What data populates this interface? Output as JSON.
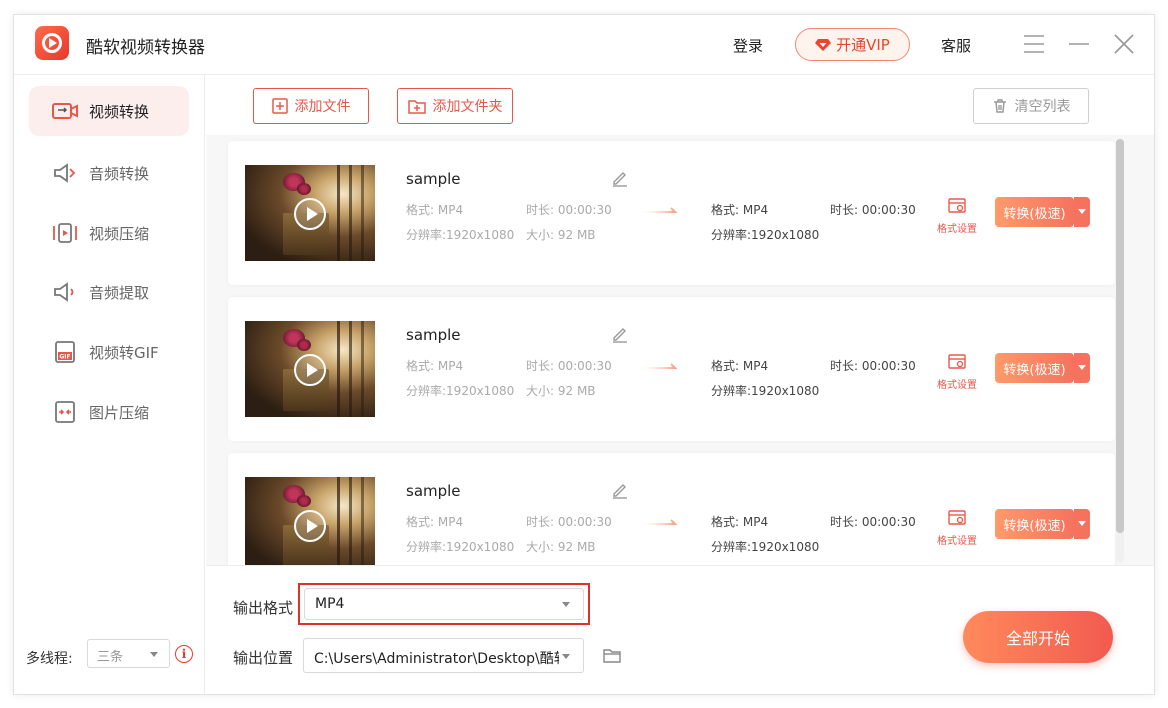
{
  "app": {
    "title": "酷软视频转换器",
    "login": "登录",
    "vip": "开通VIP",
    "service": "客服"
  },
  "sidebar": {
    "items": [
      {
        "label": "视频转换",
        "icon": "video-convert-icon",
        "active": true
      },
      {
        "label": "音频转换",
        "icon": "audio-convert-icon",
        "active": false
      },
      {
        "label": "视频压缩",
        "icon": "video-compress-icon",
        "active": false
      },
      {
        "label": "音频提取",
        "icon": "audio-extract-icon",
        "active": false
      },
      {
        "label": "视频转GIF",
        "icon": "gif-icon",
        "active": false
      },
      {
        "label": "图片压缩",
        "icon": "image-compress-icon",
        "active": false
      }
    ],
    "thread_label": "多线程:",
    "thread_value": "三条"
  },
  "toolbar": {
    "add_file": "添加文件",
    "add_folder": "添加文件夹",
    "clear_list": "清空列表"
  },
  "files": [
    {
      "name": "sample",
      "src_format": "格式: MP4",
      "src_duration": "时长: 00:00:30",
      "src_resolution": "分辨率:1920x1080",
      "src_size": "大小: 92 MB",
      "dst_format": "格式: MP4",
      "dst_duration": "时长: 00:00:30",
      "dst_resolution": "分辨率:1920x1080",
      "format_settings": "格式设置",
      "convert": "转换(极速)"
    },
    {
      "name": "sample",
      "src_format": "格式: MP4",
      "src_duration": "时长: 00:00:30",
      "src_resolution": "分辨率:1920x1080",
      "src_size": "大小: 92 MB",
      "dst_format": "格式: MP4",
      "dst_duration": "时长: 00:00:30",
      "dst_resolution": "分辨率:1920x1080",
      "format_settings": "格式设置",
      "convert": "转换(极速)"
    },
    {
      "name": "sample",
      "src_format": "格式: MP4",
      "src_duration": "时长: 00:00:30",
      "src_resolution": "分辨率:1920x1080",
      "src_size": "大小: 92 MB",
      "dst_format": "格式: MP4",
      "dst_duration": "时长: 00:00:30",
      "dst_resolution": "分辨率:1920x1080",
      "format_settings": "格式设置",
      "convert": "转换(极速)"
    }
  ],
  "output": {
    "format_label": "输出格式",
    "format_value": "MP4",
    "location_label": "输出位置",
    "location_value": "C:\\Users\\Administrator\\Desktop\\酷软",
    "start_all": "全部开始"
  },
  "colors": {
    "accent": "#e8584a",
    "highlight": "#e0302a"
  }
}
